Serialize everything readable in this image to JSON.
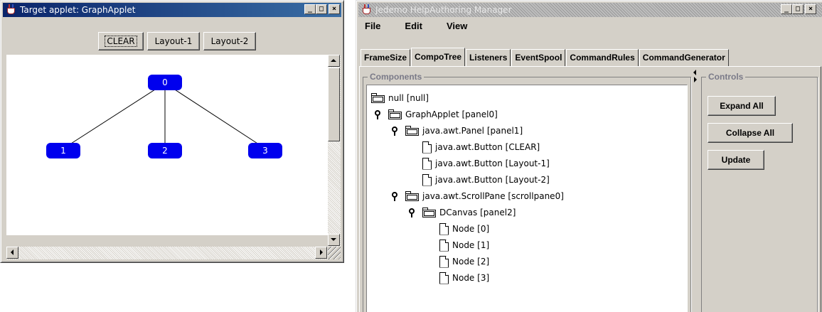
{
  "applet": {
    "title": "Target applet: GraphApplet",
    "buttons": [
      "CLEAR",
      "Layout-1",
      "Layout-2"
    ],
    "graph": {
      "node_color": "#0000ee",
      "nodes": [
        "0",
        "1",
        "2",
        "3"
      ]
    }
  },
  "manager": {
    "title": "Jedemo HelpAuthoring Manager",
    "menus": [
      "File",
      "Edit",
      "View"
    ],
    "tabs": [
      "FrameSize",
      "CompoTree",
      "Listeners",
      "EventSpool",
      "CommandRules",
      "CommandGenerator"
    ],
    "selected_tab": "CompoTree",
    "components_label": "Components",
    "controls_label": "Controls",
    "controls": [
      "Expand All",
      "Collapse All",
      "Update"
    ],
    "tree": [
      {
        "label": "null [null]",
        "depth": 0,
        "kind": "folder",
        "expanded": false
      },
      {
        "label": "GraphApplet [panel0]",
        "depth": 1,
        "kind": "folder",
        "expanded": true
      },
      {
        "label": "java.awt.Panel [panel1]",
        "depth": 2,
        "kind": "folder",
        "expanded": true
      },
      {
        "label": "java.awt.Button [CLEAR]",
        "depth": 3,
        "kind": "leaf"
      },
      {
        "label": "java.awt.Button [Layout-1]",
        "depth": 3,
        "kind": "leaf"
      },
      {
        "label": "java.awt.Button [Layout-2]",
        "depth": 3,
        "kind": "leaf"
      },
      {
        "label": "java.awt.ScrollPane [scrollpane0]",
        "depth": 2,
        "kind": "folder",
        "expanded": true
      },
      {
        "label": "DCanvas [panel2]",
        "depth": 3,
        "kind": "folder",
        "expanded": true
      },
      {
        "label": "Node [0]",
        "depth": 4,
        "kind": "leaf"
      },
      {
        "label": "Node [1]",
        "depth": 4,
        "kind": "leaf"
      },
      {
        "label": "Node [2]",
        "depth": 4,
        "kind": "leaf"
      },
      {
        "label": "Node [3]",
        "depth": 4,
        "kind": "leaf"
      }
    ]
  },
  "icons": [
    "java-cup-icon",
    "minimize-icon",
    "maximize-icon",
    "close-icon",
    "folder-icon",
    "file-icon",
    "key-expand-icon"
  ]
}
